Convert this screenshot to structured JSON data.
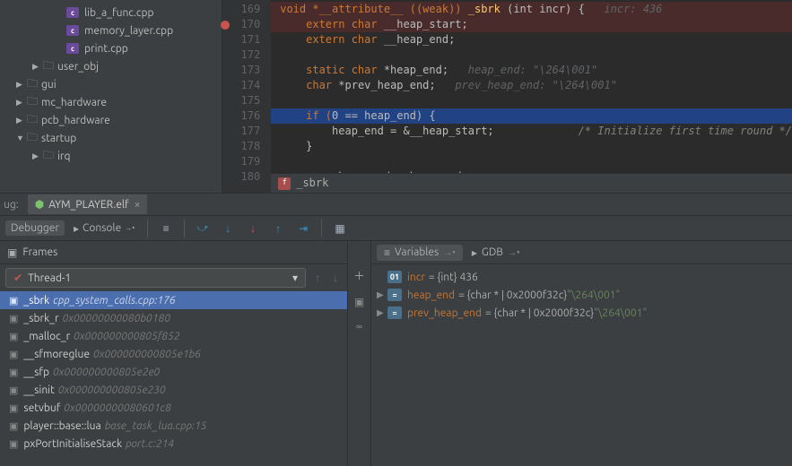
{
  "project_tree": {
    "items": [
      {
        "depth": 2,
        "icon": "cpp",
        "text": "lib_a_func.cpp"
      },
      {
        "depth": 2,
        "icon": "cpp",
        "text": "memory_layer.cpp"
      },
      {
        "depth": 2,
        "icon": "cpp",
        "text": "print.cpp"
      },
      {
        "depth": 1,
        "icon": "folder",
        "triangle": "right",
        "text": "user_obj"
      },
      {
        "depth": 0,
        "icon": "folder",
        "triangle": "right",
        "text": "gui"
      },
      {
        "depth": 0,
        "icon": "folder",
        "triangle": "right",
        "text": "mc_hardware"
      },
      {
        "depth": 0,
        "icon": "folder",
        "triangle": "right",
        "text": "pcb_hardware"
      },
      {
        "depth": 0,
        "icon": "folder",
        "triangle": "down",
        "text": "startup"
      },
      {
        "depth": 1,
        "icon": "folder",
        "triangle": "right",
        "text": "irq"
      }
    ]
  },
  "editor": {
    "gutter": [
      "169",
      "170",
      "171",
      "172",
      "173",
      "174",
      "175",
      "176",
      "177",
      "178",
      "179",
      "180"
    ],
    "lines": {
      "l169_pre": "void *__attribute__ ((weak)) ",
      "l169_fn": "_sbrk",
      "l169_post": " (int incr) {   ",
      "l169_hint": "incr: 436",
      "l170_a": "    extern char ",
      "l170_b": "__heap_start",
      "l170_c": ";",
      "l171_a": "    extern char ",
      "l171_b": "__heap_end",
      "l171_c": ";",
      "l173_a": "    static char ",
      "l173_b": "*heap_end;   ",
      "l173_hint": "heap_end: \"\\264\\001\"",
      "l174_a": "    char ",
      "l174_b": "*prev_heap_end;   ",
      "l174_hint": "prev_heap_end: \"\\264\\001\"",
      "l176_a": "    if (",
      "l176_b": "0",
      "l176_c": " == heap_end) {",
      "l177_a": "        heap_end = &__heap_start;             ",
      "l177_cmt": "/* Initialize first time round */",
      "l178": "    }",
      "l180": "    prev heap end = heap end;"
    },
    "breadcrumb": "_sbrk"
  },
  "debug_tab": {
    "prefix": "ug:",
    "tab_title": "AYM_PLAYER.elf"
  },
  "toolbar": {
    "debugger": "Debugger",
    "console": "Console"
  },
  "frames": {
    "title": "Frames",
    "thread": "Thread-1",
    "stack": [
      {
        "fn": "_sbrk",
        "loc": "cpp_system_calls.cpp:176",
        "sel": true
      },
      {
        "fn": "_sbrk_r",
        "loc": "0x00000000080b0180"
      },
      {
        "fn": "_malloc_r",
        "loc": "0x000000000805f852"
      },
      {
        "fn": "__sfmoreglue",
        "loc": "0x000000000805e1b6"
      },
      {
        "fn": "__sfp",
        "loc": "0x000000000805e2e0"
      },
      {
        "fn": "__sinit",
        "loc": "0x000000000805e230"
      },
      {
        "fn": "setvbuf",
        "loc": "0x00000000080601c8"
      },
      {
        "fn": "player::base::lua",
        "loc": "base_task_lua.cpp:15",
        "italic": true
      },
      {
        "fn": "pxPortInitialiseStack",
        "loc": "port.c:214",
        "italic": true
      }
    ]
  },
  "variables": {
    "tab_variables": "Variables",
    "tab_gdb": "GDB",
    "rows": [
      {
        "badge": "01",
        "name": "incr",
        "val": " = {int} 436"
      },
      {
        "arrow": true,
        "badge": "eq",
        "name": "heap_end",
        "val": " = {char * | 0x2000f32c} ",
        "str": "\"\\264\\001\""
      },
      {
        "arrow": true,
        "badge": "eq",
        "name": "prev_heap_end",
        "val": " = {char * | 0x2000f32c} ",
        "str": "\"\\264\\001\""
      }
    ]
  }
}
